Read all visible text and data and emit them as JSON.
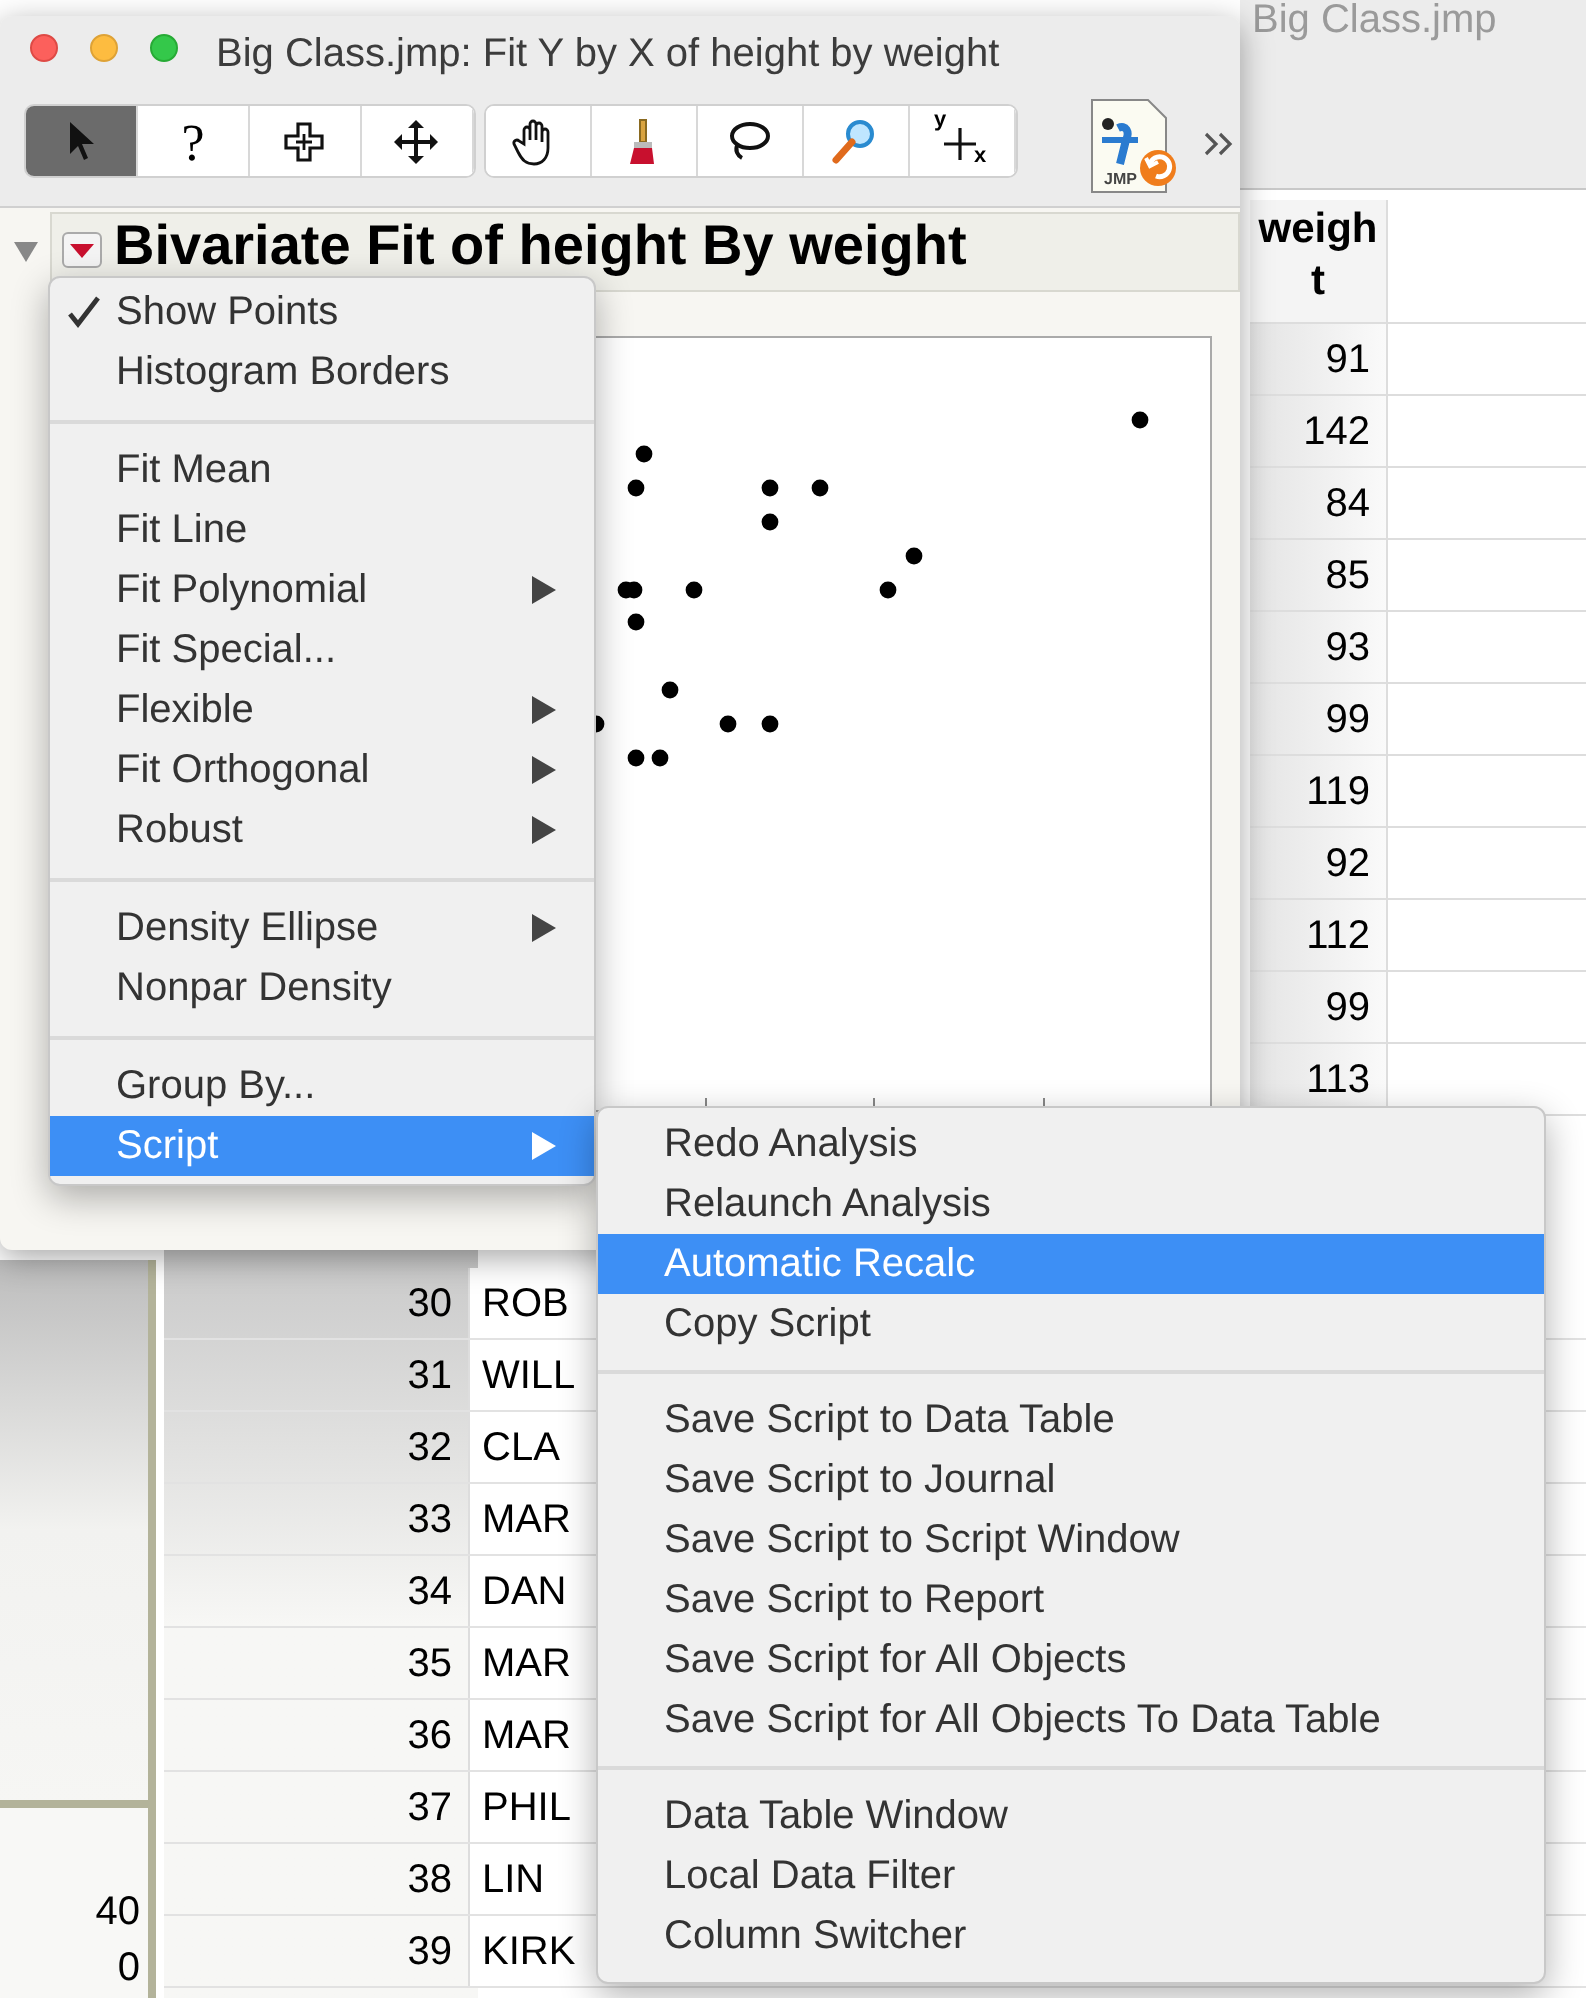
{
  "data_table_window": {
    "title": "Big Class.jmp",
    "weight_column": {
      "header": "weight",
      "values": [
        "91",
        "142",
        "84",
        "85",
        "93",
        "99",
        "119",
        "92",
        "112",
        "99",
        "113"
      ]
    },
    "rows": [
      {
        "row": "30",
        "name": "ROB"
      },
      {
        "row": "31",
        "name": "WILL"
      },
      {
        "row": "32",
        "name": "CLA"
      },
      {
        "row": "33",
        "name": "MAR"
      },
      {
        "row": "34",
        "name": "DAN"
      },
      {
        "row": "35",
        "name": "MAR"
      },
      {
        "row": "36",
        "name": "MAR"
      },
      {
        "row": "37",
        "name": "PHIL"
      },
      {
        "row": "38",
        "name": "LIN"
      },
      {
        "row": "39",
        "name": "KIRK"
      }
    ],
    "left_panel_values": [
      "40",
      "0"
    ]
  },
  "report_window": {
    "title": "Big Class.jmp: Fit Y by X of height by weight",
    "toolbar": [
      {
        "kind": "arrow",
        "selected": true
      },
      {
        "kind": "help",
        "label": "?",
        "selected": false
      },
      {
        "kind": "crosshair",
        "selected": false
      },
      {
        "kind": "move",
        "selected": false
      },
      {
        "kind": "hand",
        "selected": false
      },
      {
        "kind": "brush",
        "selected": false
      },
      {
        "kind": "lasso",
        "selected": false
      },
      {
        "kind": "magnifier",
        "selected": false
      },
      {
        "kind": "scaler",
        "label_y": "y",
        "label_x": "x",
        "selected": false
      }
    ],
    "doc_icon_label": "JMP",
    "report": {
      "expanded": true,
      "heading": "Bivariate Fit of height By weight"
    }
  },
  "menu": {
    "items": [
      {
        "kind": "item",
        "label": "Show Points",
        "checked": true,
        "submenu": false,
        "selected": false
      },
      {
        "kind": "item",
        "label": "Histogram Borders",
        "checked": false,
        "submenu": false,
        "selected": false
      },
      {
        "kind": "separator"
      },
      {
        "kind": "item",
        "label": "Fit Mean",
        "checked": false,
        "submenu": false,
        "selected": false
      },
      {
        "kind": "item",
        "label": "Fit Line",
        "checked": false,
        "submenu": false,
        "selected": false
      },
      {
        "kind": "item",
        "label": "Fit Polynomial",
        "checked": false,
        "submenu": true,
        "selected": false
      },
      {
        "kind": "item",
        "label": "Fit Special...",
        "checked": false,
        "submenu": false,
        "selected": false
      },
      {
        "kind": "item",
        "label": "Flexible",
        "checked": false,
        "submenu": true,
        "selected": false
      },
      {
        "kind": "item",
        "label": "Fit Orthogonal",
        "checked": false,
        "submenu": true,
        "selected": false
      },
      {
        "kind": "item",
        "label": "Robust",
        "checked": false,
        "submenu": true,
        "selected": false
      },
      {
        "kind": "separator"
      },
      {
        "kind": "item",
        "label": "Density Ellipse",
        "checked": false,
        "submenu": true,
        "selected": false
      },
      {
        "kind": "item",
        "label": "Nonpar Density",
        "checked": false,
        "submenu": false,
        "selected": false
      },
      {
        "kind": "separator"
      },
      {
        "kind": "item",
        "label": "Group By...",
        "checked": false,
        "submenu": false,
        "selected": false
      },
      {
        "kind": "item",
        "label": "Script",
        "checked": false,
        "submenu": true,
        "selected": true
      }
    ]
  },
  "submenu": {
    "items": [
      {
        "kind": "item",
        "label": "Redo Analysis",
        "selected": false
      },
      {
        "kind": "item",
        "label": "Relaunch Analysis",
        "selected": false
      },
      {
        "kind": "item",
        "label": "Automatic Recalc",
        "selected": true
      },
      {
        "kind": "item",
        "label": "Copy Script",
        "selected": false
      },
      {
        "kind": "separator"
      },
      {
        "kind": "item",
        "label": "Save Script to Data Table",
        "selected": false
      },
      {
        "kind": "item",
        "label": "Save Script to Journal",
        "selected": false
      },
      {
        "kind": "item",
        "label": "Save Script to Script Window",
        "selected": false
      },
      {
        "kind": "item",
        "label": "Save Script to Report",
        "selected": false
      },
      {
        "kind": "item",
        "label": "Save Script for All Objects",
        "selected": false
      },
      {
        "kind": "item",
        "label": "Save Script for All Objects To Data Table",
        "selected": false
      },
      {
        "kind": "separator"
      },
      {
        "kind": "item",
        "label": "Data Table Window",
        "selected": false
      },
      {
        "kind": "item",
        "label": "Local Data Filter",
        "selected": false
      },
      {
        "kind": "item",
        "label": "Column Switcher",
        "selected": false
      }
    ]
  }
}
